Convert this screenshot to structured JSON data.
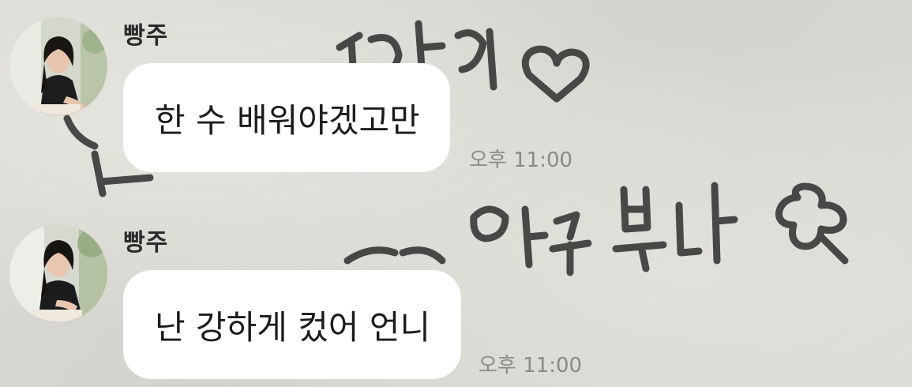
{
  "chat": {
    "messages": [
      {
        "sender": "빵주",
        "text": "한 수 배워야겠고만",
        "time": "오후 11:00"
      },
      {
        "sender": "빵주",
        "text": "난 강하게 컸어 언니",
        "time": "오후 11:00"
      }
    ]
  },
  "wallpaper": {
    "handwriting": "사랑해 하루 보내",
    "ink_color": "#2a2a2a"
  },
  "colors": {
    "bubble": "#ffffff",
    "name_text": "#2b2b2b",
    "time_text": "#8c8a86"
  }
}
